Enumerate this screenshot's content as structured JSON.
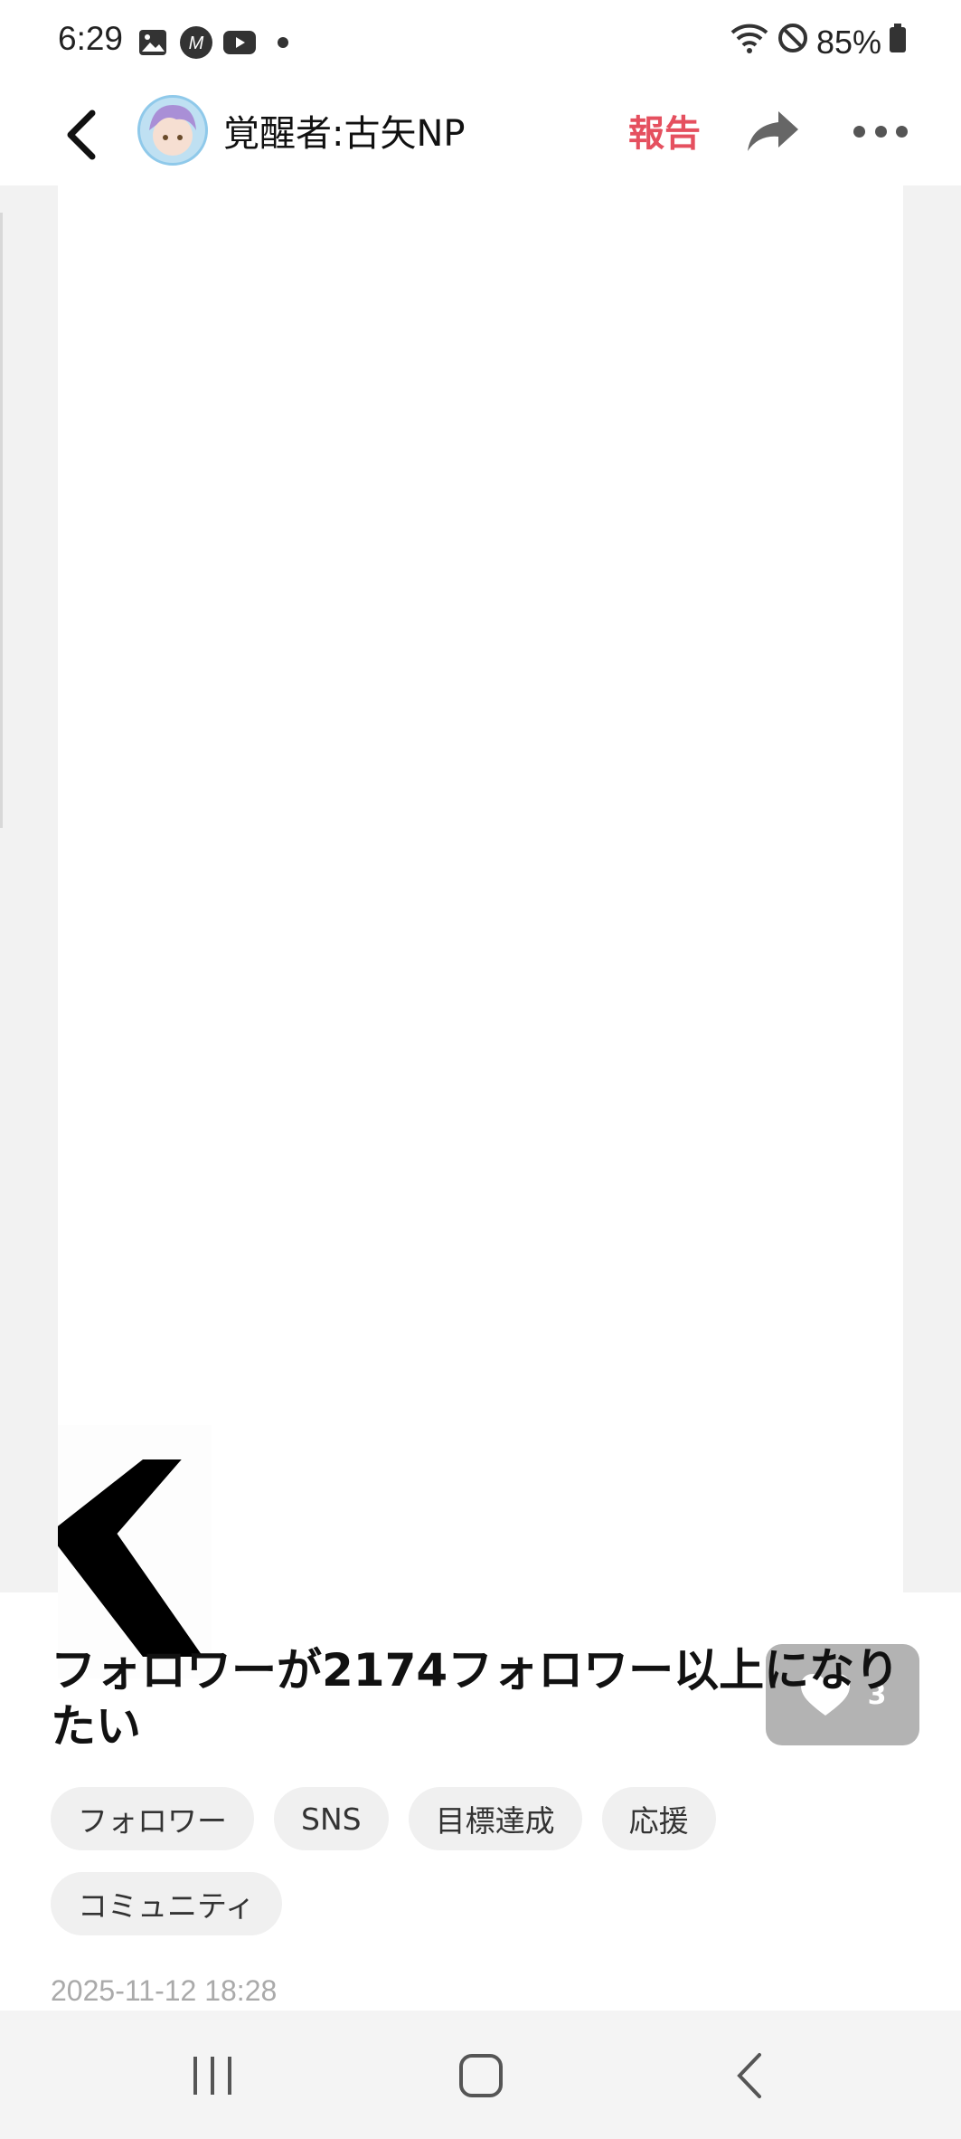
{
  "status_bar": {
    "time": "6:29",
    "notification_icons": [
      "image-icon",
      "m-app-icon",
      "youtube-icon",
      "dot-icon"
    ],
    "battery": "85%"
  },
  "app_bar": {
    "username": "覚醒者:古矢NP",
    "report_label": "報告",
    "report_color": "#e5505f"
  },
  "post": {
    "likes": "3",
    "title": "フォロワーが2174フォロワー以上になりたい",
    "tags": [
      "フォロワー",
      "SNS",
      "目標達成",
      "応援",
      "コミュニティ"
    ],
    "date": "2025-11-12 18:28"
  },
  "nav_bar": [
    "recents-icon",
    "home-icon",
    "back-icon"
  ]
}
